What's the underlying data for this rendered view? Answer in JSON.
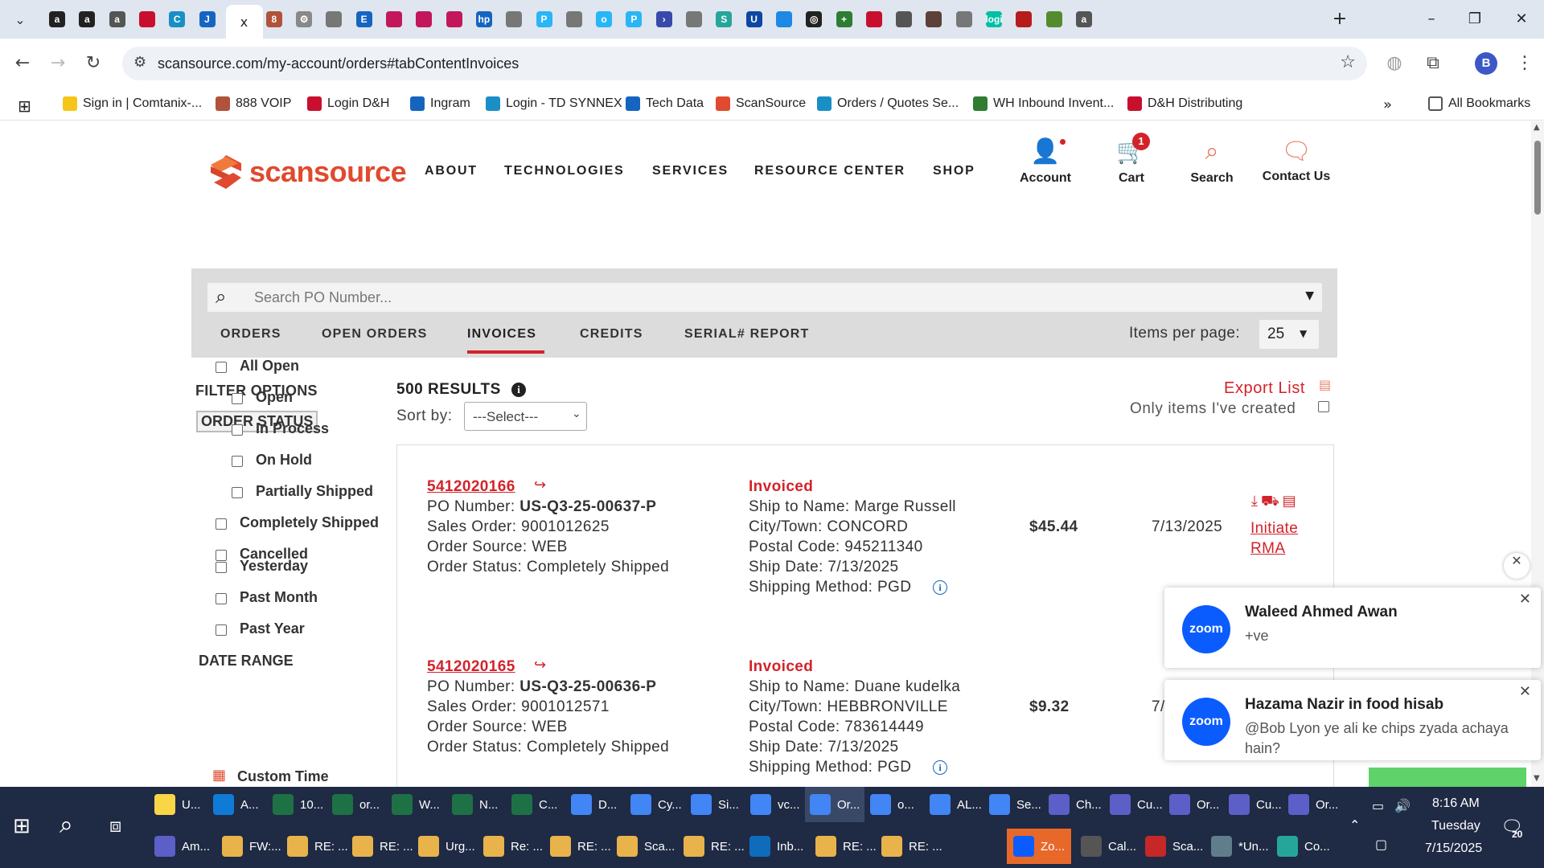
{
  "browser": {
    "tabs": [
      {
        "icon": "amazon-icon",
        "color": "#222",
        "glyph": "a"
      },
      {
        "icon": "amazon-icon",
        "color": "#222",
        "glyph": "a"
      },
      {
        "icon": "site-icon",
        "color": "#555",
        "glyph": "a"
      },
      {
        "icon": "dh-icon",
        "color": "#c8102e",
        "glyph": ""
      },
      {
        "icon": "synnex-icon",
        "color": "#1a8fc6",
        "glyph": "C"
      },
      {
        "icon": "ingram-icon",
        "color": "#1565c0",
        "glyph": "J"
      },
      {
        "icon": "scansource-icon",
        "color": "#444",
        "glyph": "x"
      },
      {
        "icon": "voip-icon",
        "color": "#b0533a",
        "glyph": "8"
      },
      {
        "icon": "settings-icon",
        "color": "#888",
        "glyph": "⚙"
      },
      {
        "icon": "globe-icon",
        "color": "#777",
        "glyph": ""
      },
      {
        "icon": "e-icon",
        "color": "#1565c0",
        "glyph": "E"
      },
      {
        "icon": "lg-icon",
        "color": "#c2185b",
        "glyph": ""
      },
      {
        "icon": "lg-icon",
        "color": "#c2185b",
        "glyph": ""
      },
      {
        "icon": "lg-icon",
        "color": "#c2185b",
        "glyph": ""
      },
      {
        "icon": "hp-icon",
        "color": "#1565c0",
        "glyph": "hp"
      },
      {
        "icon": "globe-icon",
        "color": "#777",
        "glyph": ""
      },
      {
        "icon": "p-icon",
        "color": "#29b6f6",
        "glyph": "P"
      },
      {
        "icon": "globe-icon",
        "color": "#777",
        "glyph": ""
      },
      {
        "icon": "o-icon",
        "color": "#29b6f6",
        "glyph": "o"
      },
      {
        "icon": "p-icon",
        "color": "#29b6f6",
        "glyph": "P"
      },
      {
        "icon": "arrow-icon",
        "color": "#3949ab",
        "glyph": "›"
      },
      {
        "icon": "globe-icon",
        "color": "#777",
        "glyph": ""
      },
      {
        "icon": "s-icon",
        "color": "#26a69a",
        "glyph": "S"
      },
      {
        "icon": "u-icon",
        "color": "#0d47a1",
        "glyph": "U"
      },
      {
        "icon": "cloud-icon",
        "color": "#1e88e5",
        "glyph": ""
      },
      {
        "icon": "openai-icon",
        "color": "#222",
        "glyph": "◎"
      },
      {
        "icon": "plus-icon",
        "color": "#2e7d32",
        "glyph": "+"
      },
      {
        "icon": "dh-icon",
        "color": "#c8102e",
        "glyph": ""
      },
      {
        "icon": "chart-icon",
        "color": "#555",
        "glyph": ""
      },
      {
        "icon": "bridge-icon",
        "color": "#5d4037",
        "glyph": ""
      },
      {
        "icon": "globe-icon",
        "color": "#777",
        "glyph": ""
      },
      {
        "icon": "logi-icon",
        "color": "#00bfa5",
        "glyph": "logi"
      },
      {
        "icon": "car-icon",
        "color": "#b71c1c",
        "glyph": ""
      },
      {
        "icon": "leaf-icon",
        "color": "#558b2f",
        "glyph": ""
      },
      {
        "icon": "a-icon",
        "color": "#555",
        "glyph": "a"
      }
    ],
    "url": "scansource.com/my-account/orders#tabContentInvoices",
    "profile_letter": "B",
    "bookmarks": [
      {
        "label": "Sign in | Comtanix-...",
        "color": "#f5c518"
      },
      {
        "label": "888 VOIP",
        "color": "#b0533a"
      },
      {
        "label": "Login D&H",
        "color": "#c8102e"
      },
      {
        "label": "Ingram",
        "color": "#1565c0"
      },
      {
        "label": "Login - TD SYNNEX",
        "color": "#1a8fc6"
      },
      {
        "label": "Tech Data",
        "color": "#1565c0"
      },
      {
        "label": "ScanSource",
        "color": "#e04a2f"
      },
      {
        "label": "Orders / Quotes Se...",
        "color": "#1a8fc6"
      },
      {
        "label": "WH Inbound Invent...",
        "color": "#2e7d32"
      },
      {
        "label": "D&H Distributing",
        "color": "#c8102e"
      }
    ],
    "all_bookmarks": "All Bookmarks"
  },
  "site": {
    "logo_text": "scansource",
    "nav": [
      "ABOUT",
      "TECHNOLOGIES",
      "SERVICES",
      "RESOURCE CENTER",
      "SHOP"
    ],
    "account": "Account",
    "cart": "Cart",
    "cart_count": "1",
    "search": "Search",
    "contact": "Contact Us",
    "search_placeholder": "Search PO Number...",
    "subtabs": [
      "ORDERS",
      "OPEN ORDERS",
      "INVOICES",
      "CREDITS",
      "SERIAL# REPORT"
    ],
    "items_per_page_label": "Items per page:",
    "items_per_page_value": "25",
    "filter_title": "FILTER OPTIONS",
    "order_status_title": "ORDER STATUS",
    "order_status": [
      "All Open",
      "Open",
      "In Process",
      "On Hold",
      "Partially Shipped",
      "Completely Shipped",
      "Cancelled"
    ],
    "date_range_title": "DATE RANGE",
    "date_range": [
      "Yesterday",
      "Past Month",
      "Past Year"
    ],
    "custom_time": "Custom Time",
    "results": "500 RESULTS",
    "sort_by": "Sort by:",
    "sort_value": "---Select---",
    "export_list": "Export List",
    "only_mine": "Only items I've created",
    "orders": [
      {
        "invoice": "5412020166",
        "po_label": "PO Number: ",
        "po": "US-Q3-25-00637-P",
        "sales_order": "Sales Order: 9001012625",
        "source": "Order Source: WEB",
        "status": "Order Status: Completely Shipped",
        "state": "Invoiced",
        "ship_name": "Ship to Name: Marge Russell",
        "city": "City/Town: CONCORD",
        "postal": "Postal Code: 945211340",
        "ship_date": "Ship Date: 7/13/2025",
        "method": "Shipping Method: PGD",
        "amount": "$45.44",
        "date": "7/13/2025",
        "rma": "Initiate RMA"
      },
      {
        "invoice": "5412020165",
        "po_label": "PO Number: ",
        "po": "US-Q3-25-00636-P",
        "sales_order": "Sales Order: 9001012571",
        "source": "Order Source: WEB",
        "status": "Order Status: Completely Shipped",
        "state": "Invoiced",
        "ship_name": "Ship to Name: Duane kudelka",
        "city": "City/Town: HEBBRONVILLE",
        "postal": "Postal Code: 783614449",
        "ship_date": "Ship Date: 7/13/2025",
        "method": "Shipping Method: PGD",
        "amount": "$9.32",
        "date": "7/",
        "rma": ""
      }
    ]
  },
  "notifications": [
    {
      "logo": "zoom",
      "title": "Waleed Ahmed Awan",
      "message": "+ve"
    },
    {
      "logo": "zoom",
      "title": "Hazama Nazir in food hisab",
      "message": "@Bob Lyon ye ali ke chips zyada achaya hain?"
    }
  ],
  "taskbar": {
    "row1": [
      {
        "label": "U...",
        "color": "#f9d648"
      },
      {
        "label": "A...",
        "color": "#0f7bd6"
      },
      {
        "label": "10...",
        "color": "#1e7145"
      },
      {
        "label": "or...",
        "color": "#1e7145"
      },
      {
        "label": "W...",
        "color": "#1e7145"
      },
      {
        "label": "N...",
        "color": "#1e7145"
      },
      {
        "label": "C...",
        "color": "#1e7145"
      },
      {
        "label": "D...",
        "color": "#4285f4"
      },
      {
        "label": "Cy...",
        "color": "#4285f4"
      },
      {
        "label": "Si...",
        "color": "#4285f4"
      },
      {
        "label": "vc...",
        "color": "#4285f4"
      },
      {
        "label": "Or...",
        "color": "#4285f4"
      },
      {
        "label": "o...",
        "color": "#4285f4"
      },
      {
        "label": "AL...",
        "color": "#4285f4"
      },
      {
        "label": "Se...",
        "color": "#4285f4"
      },
      {
        "label": "Ch...",
        "color": "#5b5fc7"
      },
      {
        "label": "Cu...",
        "color": "#5b5fc7"
      },
      {
        "label": "Or...",
        "color": "#5b5fc7"
      },
      {
        "label": "Cu...",
        "color": "#5b5fc7"
      },
      {
        "label": "Or...",
        "color": "#5b5fc7"
      }
    ],
    "row2": [
      {
        "label": "Am...",
        "color": "#5b5fc7"
      },
      {
        "label": "FW:...",
        "color": "#e8b34a"
      },
      {
        "label": "RE: ...",
        "color": "#e8b34a"
      },
      {
        "label": "RE: ...",
        "color": "#e8b34a"
      },
      {
        "label": "Urg...",
        "color": "#e8b34a"
      },
      {
        "label": "Re: ...",
        "color": "#e8b34a"
      },
      {
        "label": "RE: ...",
        "color": "#e8b34a"
      },
      {
        "label": "Sca...",
        "color": "#e8b34a"
      },
      {
        "label": "RE: ...",
        "color": "#e8b34a"
      },
      {
        "label": "Inb...",
        "color": "#0f6cbd"
      },
      {
        "label": "RE: ...",
        "color": "#e8b34a"
      },
      {
        "label": "RE: ...",
        "color": "#e8b34a"
      },
      {
        "label": "Zo...",
        "color": "#0b5cff"
      },
      {
        "label": "Cal...",
        "color": "#555"
      },
      {
        "label": "Sca...",
        "color": "#c62828"
      },
      {
        "label": "*Un...",
        "color": "#607d8b"
      },
      {
        "label": "Co...",
        "color": "#26a69a"
      }
    ],
    "time": "8:16 AM",
    "day": "Tuesday",
    "date": "7/15/2025",
    "notif_count": "20"
  }
}
